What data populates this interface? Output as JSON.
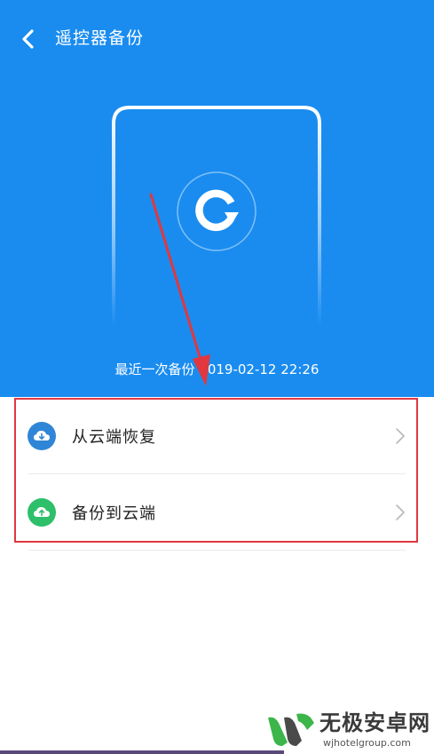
{
  "header": {
    "title": "遥控器备份",
    "back_icon": "chevron-left-icon"
  },
  "hero": {
    "background_color": "#1a8cf0",
    "center_icon": "sync-icon",
    "last_backup_text": "最近一次备份 2019-02-12 22:26"
  },
  "menu": {
    "items": [
      {
        "label": "从云端恢复",
        "icon": "cloud-download-icon",
        "icon_color": "#2f86d6",
        "chevron": "chevron-right-icon"
      },
      {
        "label": "备份到云端",
        "icon": "cloud-upload-icon",
        "icon_color": "#2dbf6a",
        "chevron": "chevron-right-icon"
      }
    ]
  },
  "annotation": {
    "highlight_color": "#e0383e"
  },
  "watermark": {
    "name": "无极安卓网",
    "url": "wjhotelgroup.com"
  }
}
